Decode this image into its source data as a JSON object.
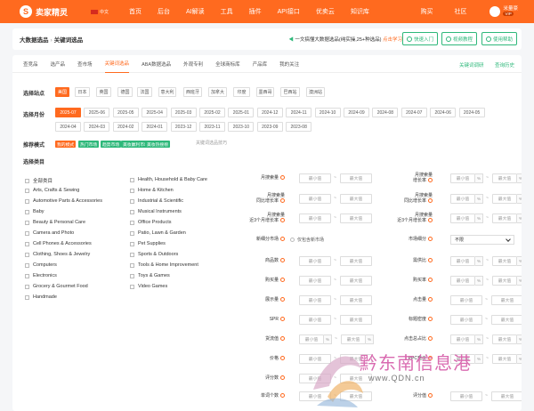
{
  "nav": {
    "brand": "卖家精灵",
    "lang": "中文",
    "items": [
      "首页",
      "后台",
      "AI解读",
      "工具",
      "插件",
      "API接口",
      "优卖云",
      "知识库"
    ],
    "right": [
      "购买",
      "社区"
    ],
    "user": "米量豪",
    "vip": "VIP"
  },
  "top": {
    "breadcrumb_root": "大数据选品",
    "breadcrumb_sep": "›",
    "breadcrumb_current": "关键词选品",
    "promo_prefix": "一文搞懂大数据选品(纯实操,",
    "promo_green": "25+种选品",
    "promo_suffix": ")",
    "promo_link": "点击学习",
    "buttons": [
      "快速入门",
      "视频教程",
      "使用帮助"
    ]
  },
  "tabs": {
    "items": [
      "查竞品",
      "选产品",
      "查市场",
      "关键词选品",
      "ABA数据选品",
      "外观专利",
      "全球商标库",
      "产品库",
      "我的关注"
    ],
    "active": 3,
    "right_links": [
      "关键词调研",
      "查询历史"
    ]
  },
  "site": {
    "label": "选择站点",
    "options": [
      "美国",
      "日本",
      "英国",
      "德国",
      "法国",
      "意大利",
      "西班牙",
      "加拿大",
      "印度",
      "墨西哥",
      "巴西站",
      "澳洲站"
    ],
    "selected": 0
  },
  "month": {
    "label": "选择月份",
    "row1": [
      "2025-07",
      "2025-06",
      "2025-05",
      "2025-04",
      "2025-03",
      "2025-02",
      "2025-01",
      "2024-12",
      "2024-11",
      "2024-10",
      "2024-09",
      "2024-08",
      "2024-07",
      "2024-06",
      "2024-05"
    ],
    "row2": [
      "2024-04",
      "2024-03",
      "2024-02",
      "2024-01",
      "2023-12",
      "2023-11",
      "2023-10",
      "2023-09",
      "2023-08"
    ],
    "selected": "2025-07"
  },
  "mode": {
    "label": "推荐模式",
    "items": [
      "我的模式",
      "热门市场",
      "趋势市场",
      "美妆赢利市场",
      "美妆热搜榜"
    ],
    "link": "关键词选品技巧"
  },
  "category": {
    "label": "选择类目",
    "col1": [
      "全部类目",
      "Arts, Crafts & Sewing",
      "Automotive Parts & Accessories",
      "Baby",
      "Beauty & Personal Care",
      "Camera and Photo",
      "Cell Phones & Accessories",
      "Clothing, Shoes & Jewelry",
      "Computers",
      "Electronics",
      "Grocery & Gourmet Food",
      "Handmade"
    ],
    "col2": [
      "Health, Household & Baby Care",
      "Home & Kitchen",
      "Industrial & Scientific",
      "Musical Instruments",
      "Office Products",
      "Patio, Lawn & Garden",
      "Pet Supplies",
      "Sports & Outdoors",
      "Tools & Home Improvement",
      "Toys & Games",
      "Video Games"
    ]
  },
  "filters": {
    "min": "最小值",
    "max": "最大值",
    "pct": "%",
    "dash": "~",
    "left": [
      "月搜索量",
      "月搜索量\n同比增长率",
      "月搜索量\n近3个月增长率",
      "新细分市场",
      "商品数",
      "购买量",
      "展示量",
      "SPR",
      "货流值",
      "价格",
      "评分数",
      "单词个数"
    ],
    "right": [
      "月搜索量\n增长率",
      "月搜索量\n同比增长率",
      "月搜索量\n近3个月增长率",
      "市场细分",
      "需供比",
      "购买率",
      "点击量",
      "标题密度",
      "点击总占比",
      "PPC竞价",
      "",
      "评分值"
    ],
    "only_new": "仅包含新市场",
    "segment_value": "不限"
  },
  "watermark": {
    "text": "黔东南信息港",
    "url": "www.QDN.cn"
  }
}
